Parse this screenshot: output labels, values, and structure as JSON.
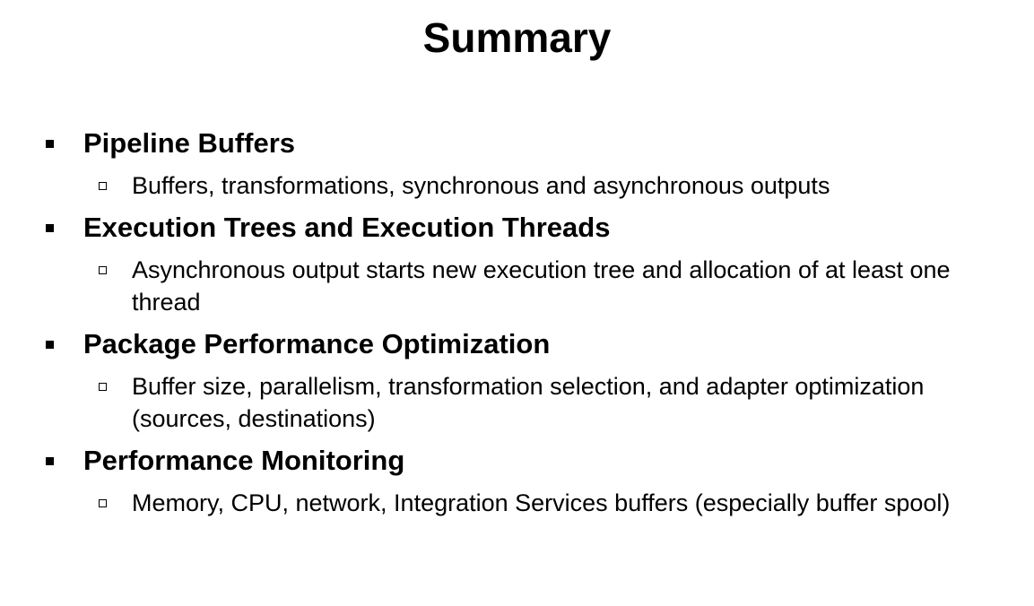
{
  "slide": {
    "title": "Summary",
    "items": [
      {
        "heading": "Pipeline Buffers",
        "detail": "Buffers, transformations, synchronous and asynchronous outputs"
      },
      {
        "heading": "Execution Trees and Execution Threads",
        "detail": "Asynchronous output starts new execution tree and allocation of at least one thread"
      },
      {
        "heading": "Package Performance Optimization",
        "detail": "Buffer size, parallelism, transformation selection, and adapter optimization (sources, destinations)"
      },
      {
        "heading": "Performance Monitoring",
        "detail": "Memory, CPU, network, Integration Services buffers (especially buffer spool)"
      }
    ]
  }
}
